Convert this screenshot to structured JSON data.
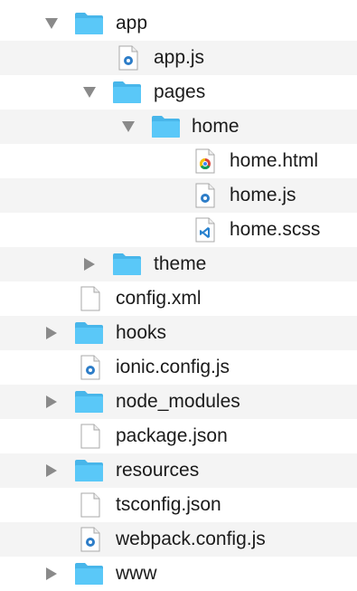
{
  "tree": {
    "items": [
      {
        "name": "app",
        "kind": "folder",
        "expanded": true
      },
      {
        "name": "app.js",
        "kind": "js"
      },
      {
        "name": "pages",
        "kind": "folder",
        "expanded": true
      },
      {
        "name": "home",
        "kind": "folder",
        "expanded": true
      },
      {
        "name": "home.html",
        "kind": "html"
      },
      {
        "name": "home.js",
        "kind": "js"
      },
      {
        "name": "home.scss",
        "kind": "scss"
      },
      {
        "name": "theme",
        "kind": "folder",
        "expanded": false
      },
      {
        "name": "config.xml",
        "kind": "file"
      },
      {
        "name": "hooks",
        "kind": "folder",
        "expanded": false
      },
      {
        "name": "ionic.config.js",
        "kind": "js"
      },
      {
        "name": "node_modules",
        "kind": "folder",
        "expanded": false
      },
      {
        "name": "package.json",
        "kind": "file"
      },
      {
        "name": "resources",
        "kind": "folder",
        "expanded": false
      },
      {
        "name": "tsconfig.json",
        "kind": "file"
      },
      {
        "name": "webpack.config.js",
        "kind": "js"
      },
      {
        "name": "www",
        "kind": "folder",
        "expanded": false
      }
    ]
  },
  "colors": {
    "folder": "#5ac8f8",
    "folder_tab": "#48b6ea",
    "disclosure": "#8a8a8a",
    "js_badge": "#2d7dc8",
    "scss_badge": "#2a83cf",
    "alt_row": "#f4f4f4"
  }
}
